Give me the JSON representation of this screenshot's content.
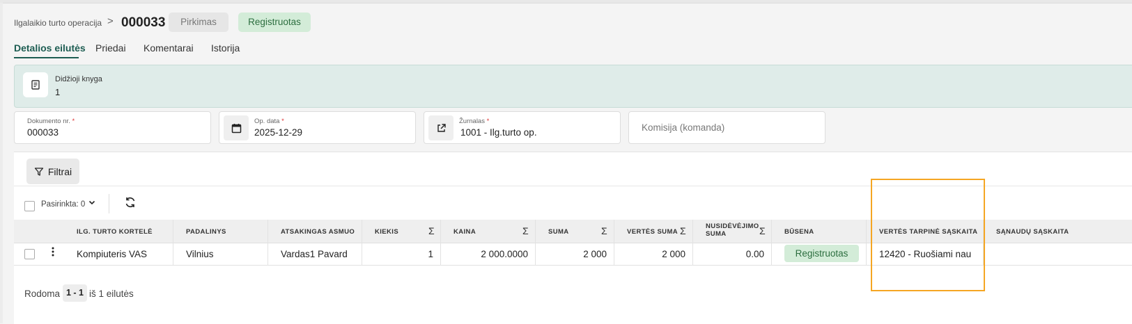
{
  "breadcrumb": {
    "parent": "Ilgalaikio turto operacija",
    "separator": ">"
  },
  "header": {
    "doc_number": "000033",
    "type_badge": "Pirkimas",
    "status_badge": "Registruotas"
  },
  "tabs": [
    "Detalios eilutės",
    "Priedai",
    "Komentarai",
    "Istorija"
  ],
  "ledger": {
    "label": "Didžioji knyga",
    "value": "1"
  },
  "fields": {
    "doc_no": {
      "label": "Dokumento nr.",
      "required": "*",
      "value": "000033"
    },
    "op_date": {
      "label": "Op. data",
      "required": "*",
      "value": "2025-12-29"
    },
    "journal": {
      "label": "Žurnalas",
      "required": "*",
      "value": "1001 - Ilg.turto op."
    },
    "commission": {
      "placeholder": "Komisija (komanda)"
    }
  },
  "toolbar": {
    "filter_label": "Filtrai",
    "selected_label": "Pasirinkta: 0"
  },
  "table": {
    "headers": {
      "card": "ILG. TURTO KORTELĖ",
      "division": "PADALINYS",
      "responsible": "ATSAKINGAS ASMUO",
      "qty": "KIEKIS",
      "price": "KAINA",
      "sum": "SUMA",
      "value_sum": "VERTĖS SUMA",
      "depreciation_1": "NUSIDĖVĖJIMO",
      "depreciation_2": "SUMA",
      "status": "BŪSENA",
      "value_account": "VERTĖS TARPINĖ SĄSKAITA",
      "cost_account": "SĄNAUDŲ SĄSKAITA"
    },
    "sigma": "Σ",
    "rows": [
      {
        "card": "Kompiuteris VAS",
        "division": "Vilnius",
        "responsible": "Vardas1 Pavard",
        "qty": "1",
        "price": "2 000.0000",
        "sum": "2 000",
        "value_sum": "2 000",
        "depreciation": "0.00",
        "status": "Registruotas",
        "value_account": "12420 - Ruošiami nau"
      }
    ]
  },
  "footer": {
    "showing_label": "Rodoma",
    "range": "1 - 1",
    "of_label": "iš 1 eilutės"
  },
  "colors": {
    "accent": "#1d5d52",
    "success_bg": "#d3ecd8",
    "highlight": "#f5a623"
  }
}
